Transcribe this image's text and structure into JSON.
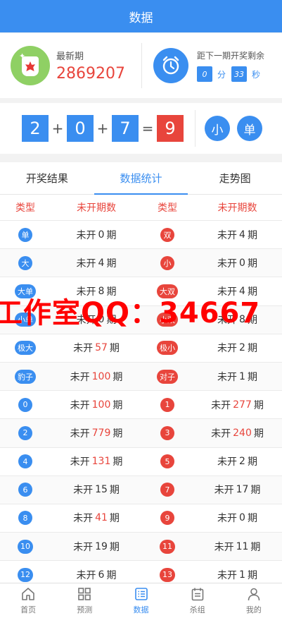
{
  "header": {
    "title": "数据"
  },
  "latest": {
    "label": "最新期",
    "number": "2869207"
  },
  "countdown": {
    "label": "距下一期开奖剩余",
    "minutes": "0",
    "minutes_unit": "分",
    "seconds": "33",
    "seconds_unit": "秒"
  },
  "result": {
    "digits": [
      "2",
      "0",
      "7"
    ],
    "ops": [
      "+",
      "+",
      "="
    ],
    "sum": "9",
    "tags": [
      "小",
      "单"
    ]
  },
  "tabs": [
    "开奖结果",
    "数据统计",
    "走势图"
  ],
  "table": {
    "headers": [
      "类型",
      "未开期数",
      "类型",
      "未开期数"
    ],
    "prefix": "未开",
    "suffix": "期",
    "rows": [
      {
        "l_type": "单",
        "l_n": "0",
        "l_hl": false,
        "r_type": "双",
        "r_n": "4",
        "r_hl": false
      },
      {
        "l_type": "大",
        "l_n": "4",
        "l_hl": false,
        "r_type": "小",
        "r_n": "0",
        "r_hl": false
      },
      {
        "l_type": "大单",
        "l_n": "8",
        "l_hl": false,
        "r_type": "大双",
        "r_n": "4",
        "r_hl": false
      },
      {
        "l_type": "小单",
        "l_n": "0",
        "l_hl": false,
        "r_type": "小双",
        "r_n": "8",
        "r_hl": false
      },
      {
        "l_type": "极大",
        "l_n": "57",
        "l_hl": true,
        "r_type": "极小",
        "r_n": "2",
        "r_hl": false
      },
      {
        "l_type": "豹子",
        "l_n": "100",
        "l_hl": true,
        "r_type": "对子",
        "r_n": "1",
        "r_hl": false
      },
      {
        "l_type": "0",
        "l_n": "100",
        "l_hl": true,
        "r_type": "1",
        "r_n": "277",
        "r_hl": true
      },
      {
        "l_type": "2",
        "l_n": "779",
        "l_hl": true,
        "r_type": "3",
        "r_n": "240",
        "r_hl": true
      },
      {
        "l_type": "4",
        "l_n": "131",
        "l_hl": true,
        "r_type": "5",
        "r_n": "2",
        "r_hl": false
      },
      {
        "l_type": "6",
        "l_n": "15",
        "l_hl": false,
        "r_type": "7",
        "r_n": "17",
        "r_hl": false
      },
      {
        "l_type": "8",
        "l_n": "41",
        "l_hl": true,
        "r_type": "9",
        "r_n": "0",
        "r_hl": false
      },
      {
        "l_type": "10",
        "l_n": "19",
        "l_hl": false,
        "r_type": "11",
        "r_n": "11",
        "r_hl": false
      },
      {
        "l_type": "12",
        "l_n": "6",
        "l_hl": false,
        "r_type": "13",
        "r_n": "1",
        "r_hl": false
      }
    ]
  },
  "watermark": "工作室QQ：34667",
  "nav": [
    {
      "label": "首页",
      "icon": "home-icon"
    },
    {
      "label": "预测",
      "icon": "grid-icon"
    },
    {
      "label": "数据",
      "icon": "list-icon",
      "active": true
    },
    {
      "label": "杀组",
      "icon": "calendar-icon"
    },
    {
      "label": "我的",
      "icon": "user-icon"
    }
  ],
  "colors": {
    "primary": "#3a8ef0",
    "accent": "#e8453c",
    "avatar": "#8fd064"
  }
}
